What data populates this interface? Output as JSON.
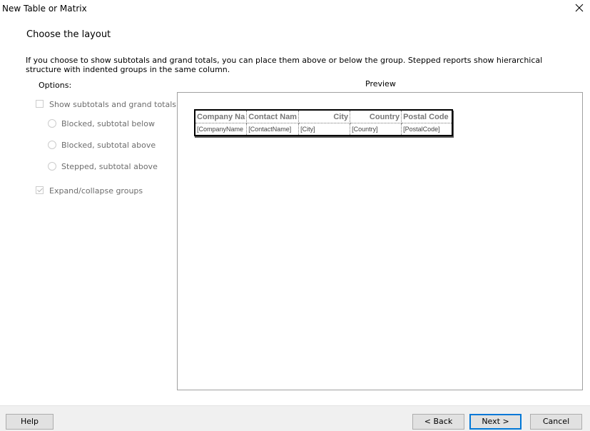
{
  "window": {
    "title": "New Table or Matrix"
  },
  "page": {
    "heading": "Choose the layout",
    "description": "If you choose to show subtotals and grand totals, you can place them above or below the group. Stepped reports show hierarchical structure with indented groups in the same column."
  },
  "options": {
    "label": "Options:",
    "show_totals": "Show subtotals and grand totals",
    "show_totals_checked": false,
    "blocked_below": "Blocked, subtotal below",
    "blocked_above": "Blocked, subtotal above",
    "stepped_above": "Stepped, subtotal above",
    "expand_collapse": "Expand/collapse groups",
    "expand_collapse_checked": true
  },
  "preview": {
    "label": "Preview",
    "headers": [
      "Company Na",
      "Contact Nam",
      "City",
      "Country",
      "Postal Code"
    ],
    "row": [
      "[CompanyName",
      "[ContactName]",
      "[City]",
      "[Country]",
      "[PostalCode]"
    ]
  },
  "buttons": {
    "help": "Help",
    "back": "< Back",
    "next": "Next >",
    "cancel": "Cancel"
  },
  "colors": {
    "accent": "#0078d7",
    "disabled_text": "#6d6d6d",
    "footer_bg": "#f0f0f0"
  }
}
